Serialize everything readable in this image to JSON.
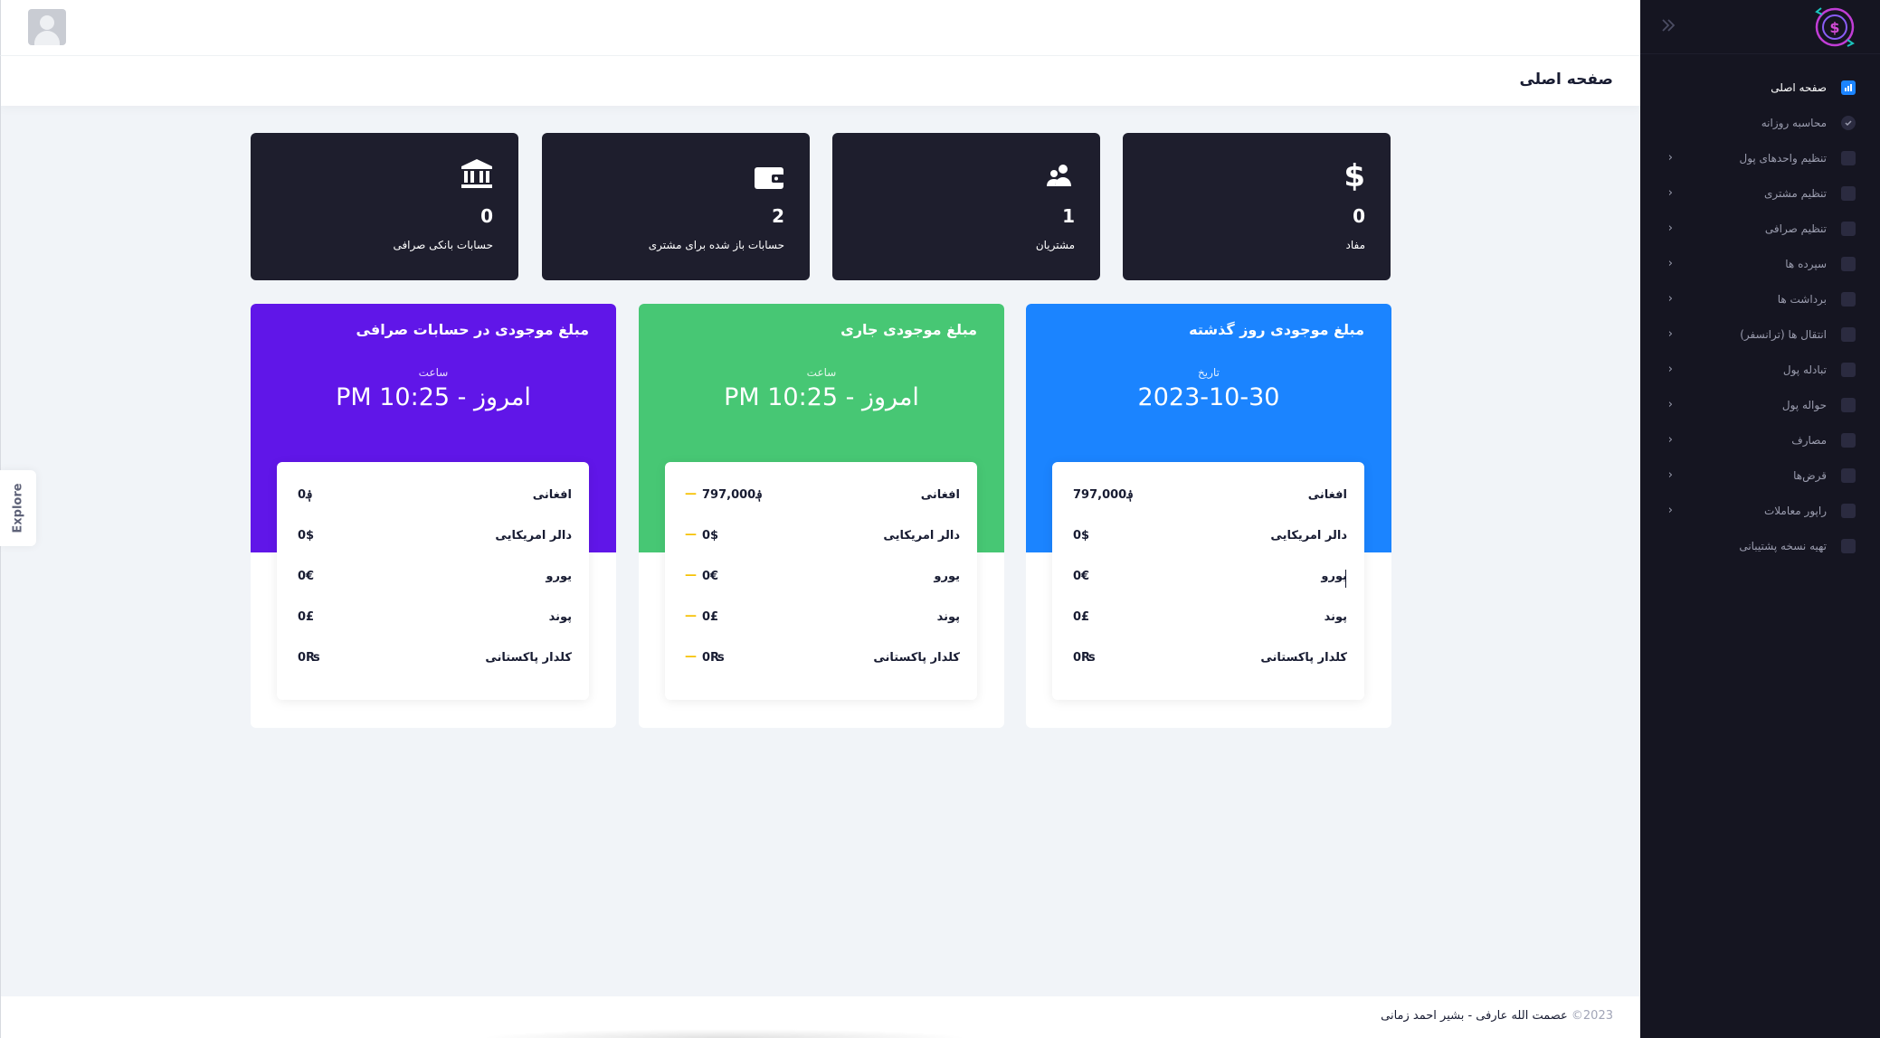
{
  "page_title": "صفحه اصلی",
  "sidebar": {
    "items": [
      {
        "label": "صفحه اصلی",
        "icon": "chart-icon",
        "active": true,
        "has_arrow": false
      },
      {
        "label": "محاسبه روزانه",
        "icon": "check-circle-icon",
        "active": false,
        "has_arrow": false
      },
      {
        "label": "تنظیم واحدهای پول",
        "icon": "currency-icon",
        "active": false,
        "has_arrow": true
      },
      {
        "label": "تنظیم مشتری",
        "icon": "card-icon",
        "active": false,
        "has_arrow": true
      },
      {
        "label": "تنظیم صرافی",
        "icon": "grid-icon",
        "active": false,
        "has_arrow": true
      },
      {
        "label": "سپرده ها",
        "icon": "plus-icon",
        "active": false,
        "has_arrow": true
      },
      {
        "label": "برداشت ها",
        "icon": "minus-icon",
        "active": false,
        "has_arrow": true
      },
      {
        "label": "انتقال ها (ترانسفر)",
        "icon": "transfer-icon",
        "active": false,
        "has_arrow": true
      },
      {
        "label": "تبادله پول",
        "icon": "exchange-icon",
        "active": false,
        "has_arrow": true
      },
      {
        "label": "حواله پول",
        "icon": "bank-icon",
        "active": false,
        "has_arrow": true
      },
      {
        "label": "مصارف",
        "icon": "expense-icon",
        "active": false,
        "has_arrow": true
      },
      {
        "label": "قرض‌ها",
        "icon": "folder-icon",
        "active": false,
        "has_arrow": true
      },
      {
        "label": "راپور معاملات",
        "icon": "report-icon",
        "active": false,
        "has_arrow": true
      },
      {
        "label": "تهیه نسخه پشتیبانی",
        "icon": "backup-icon",
        "active": false,
        "has_arrow": false
      }
    ]
  },
  "stats": [
    {
      "icon": "dollar-icon",
      "value": "0",
      "label": "مفاد"
    },
    {
      "icon": "users-icon",
      "value": "1",
      "label": "مشتریان"
    },
    {
      "icon": "wallet-icon",
      "value": "2",
      "label": "حسابات باز شده برای مشتری"
    },
    {
      "icon": "bank-icon",
      "value": "0",
      "label": "حسابات بانکی صرافی"
    }
  ],
  "balances": [
    {
      "title": "مبلغ موجودی روز گذشته",
      "sub_label": "تاریخ",
      "main_value": "2023-10-30",
      "color": "#1b84ff",
      "show_dash": false,
      "rows": [
        {
          "name": "افغانی",
          "amount": "797,000؋"
        },
        {
          "name": "دالر امریکایی",
          "amount": "0$"
        },
        {
          "name": "یورو",
          "amount": "0€"
        },
        {
          "name": "پوند",
          "amount": "0£"
        },
        {
          "name": "کلدار پاکستانی",
          "amount": "0₨"
        }
      ]
    },
    {
      "title": "مبلغ موجودی جاری",
      "sub_label": "ساعت",
      "main_value": "امروز - 10:25 PM",
      "color": "#47c774",
      "show_dash": true,
      "rows": [
        {
          "name": "افغانی",
          "amount": "797,000؋"
        },
        {
          "name": "دالر امریکایی",
          "amount": "0$"
        },
        {
          "name": "یورو",
          "amount": "0€"
        },
        {
          "name": "پوند",
          "amount": "0£"
        },
        {
          "name": "کلدار پاکستانی",
          "amount": "0₨"
        }
      ]
    },
    {
      "title": "مبلغ موجودی در حسابات صرافی",
      "sub_label": "ساعت",
      "main_value": "امروز - 10:25 PM",
      "color": "#6016e8",
      "show_dash": false,
      "rows": [
        {
          "name": "افغانی",
          "amount": "0؋"
        },
        {
          "name": "دالر امریکایی",
          "amount": "0$"
        },
        {
          "name": "یورو",
          "amount": "0€"
        },
        {
          "name": "پوند",
          "amount": "0£"
        },
        {
          "name": "کلدار پاکستانی",
          "amount": "0₨"
        }
      ]
    }
  ],
  "dash_symbol": "—",
  "explore_label": "Explore",
  "footer": {
    "year": "2023©",
    "authors": "عصمت الله عارفی - بشیر احمد زمانی"
  }
}
